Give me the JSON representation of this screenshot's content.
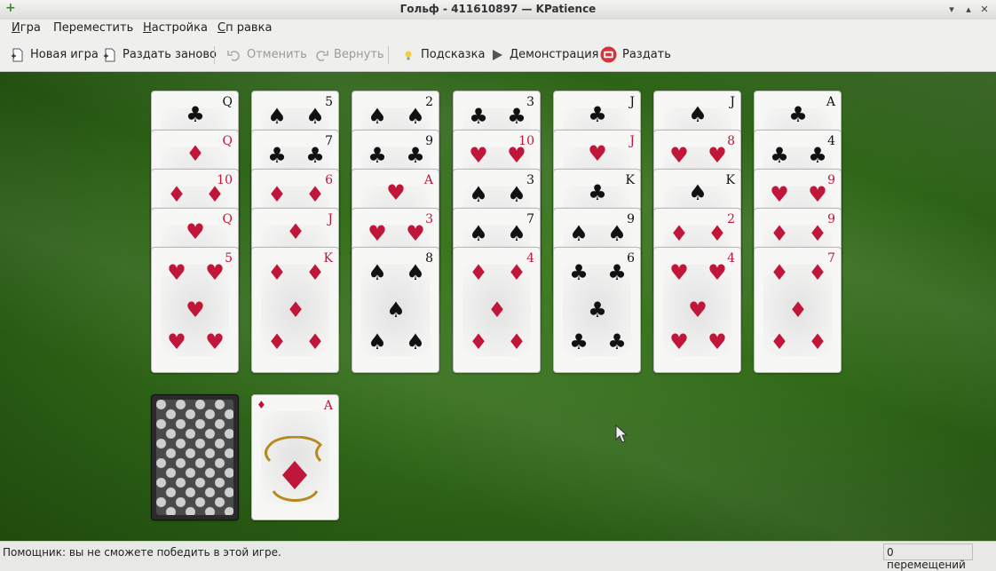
{
  "window": {
    "title": "Гольф - 411610897 — KPatience"
  },
  "menu": {
    "game": {
      "u": "И",
      "rest": "гра"
    },
    "move": {
      "u": "",
      "rest": "Переместить"
    },
    "settings": {
      "u": "Н",
      "rest": "астройка"
    },
    "help": {
      "u": "С",
      "rest": "п равка"
    }
  },
  "toolbar": {
    "new_game": "Новая игра",
    "redeal": "Раздать заново",
    "undo": "Отменить",
    "redo": "Вернуть",
    "hint": "Подсказка",
    "demo": "Демонстрация",
    "deal": "Раздать"
  },
  "tableau": [
    {
      "cards": [
        {
          "rank": "Q",
          "suit": "♣",
          "color": "black"
        },
        {
          "rank": "Q",
          "suit": "♦",
          "color": "red"
        },
        {
          "rank": "10",
          "suit": "♦",
          "color": "red"
        },
        {
          "rank": "Q",
          "suit": "♥",
          "color": "red"
        },
        {
          "rank": "5",
          "suit": "♥",
          "color": "red"
        }
      ]
    },
    {
      "cards": [
        {
          "rank": "5",
          "suit": "♠",
          "color": "black"
        },
        {
          "rank": "7",
          "suit": "♣",
          "color": "black"
        },
        {
          "rank": "6",
          "suit": "♦",
          "color": "red"
        },
        {
          "rank": "J",
          "suit": "♦",
          "color": "red"
        },
        {
          "rank": "K",
          "suit": "♦",
          "color": "red"
        }
      ]
    },
    {
      "cards": [
        {
          "rank": "2",
          "suit": "♠",
          "color": "black"
        },
        {
          "rank": "9",
          "suit": "♣",
          "color": "black"
        },
        {
          "rank": "A",
          "suit": "♥",
          "color": "red"
        },
        {
          "rank": "3",
          "suit": "♥",
          "color": "red"
        },
        {
          "rank": "8",
          "suit": "♠",
          "color": "black"
        }
      ]
    },
    {
      "cards": [
        {
          "rank": "3",
          "suit": "♣",
          "color": "black"
        },
        {
          "rank": "10",
          "suit": "♥",
          "color": "red"
        },
        {
          "rank": "3",
          "suit": "♠",
          "color": "black"
        },
        {
          "rank": "7",
          "suit": "♠",
          "color": "black"
        },
        {
          "rank": "4",
          "suit": "♦",
          "color": "red"
        }
      ]
    },
    {
      "cards": [
        {
          "rank": "J",
          "suit": "♣",
          "color": "black"
        },
        {
          "rank": "J",
          "suit": "♥",
          "color": "red"
        },
        {
          "rank": "K",
          "suit": "♣",
          "color": "black"
        },
        {
          "rank": "9",
          "suit": "♠",
          "color": "black"
        },
        {
          "rank": "6",
          "suit": "♣",
          "color": "black"
        }
      ]
    },
    {
      "cards": [
        {
          "rank": "J",
          "suit": "♠",
          "color": "black"
        },
        {
          "rank": "8",
          "suit": "♥",
          "color": "red"
        },
        {
          "rank": "K",
          "suit": "♠",
          "color": "black"
        },
        {
          "rank": "2",
          "suit": "♦",
          "color": "red"
        },
        {
          "rank": "4",
          "suit": "♥",
          "color": "red"
        }
      ]
    },
    {
      "cards": [
        {
          "rank": "A",
          "suit": "♣",
          "color": "black"
        },
        {
          "rank": "4",
          "suit": "♣",
          "color": "black"
        },
        {
          "rank": "9",
          "suit": "♥",
          "color": "red"
        },
        {
          "rank": "9",
          "suit": "♦",
          "color": "red"
        },
        {
          "rank": "7",
          "suit": "♦",
          "color": "red"
        }
      ]
    }
  ],
  "waste": {
    "rank": "A",
    "suit": "♦",
    "color": "red"
  },
  "colors": {
    "felt": "#2e6417",
    "red_suit": "#c0163a",
    "black_suit": "#111111"
  },
  "status": {
    "message": "Помощник: вы не сможете победить в этой игре.",
    "moves": "0 перемещений"
  }
}
